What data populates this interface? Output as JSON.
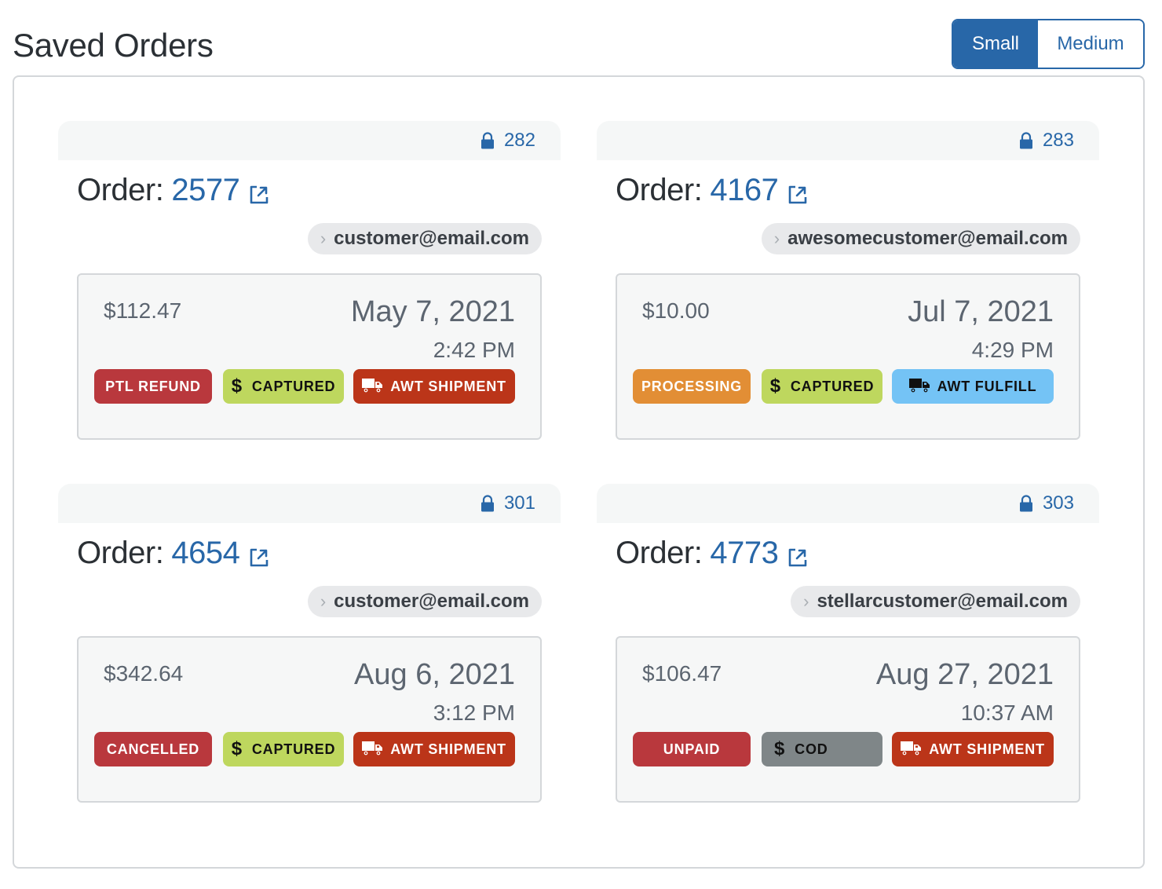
{
  "page_title": "Saved Orders",
  "size_toggle": {
    "options": [
      {
        "label": "Small",
        "selected": true
      },
      {
        "label": "Medium",
        "selected": false
      }
    ]
  },
  "colors": {
    "primary": "#2867a8",
    "danger": "#b9383d",
    "captured": "#bed75e",
    "processing": "#e28e35",
    "shipment": "#bb3519",
    "fulfill": "#74c3f5",
    "cod": "#7f8688"
  },
  "order_label": "Order:",
  "orders": [
    {
      "lock_id": "282",
      "order_number": "2577",
      "email": "customer@email.com",
      "amount": "$112.47",
      "date": "May 7, 2021",
      "time": "2:42 PM",
      "badges": [
        {
          "label": "PTL REFUND",
          "icon": "",
          "bg": "#b9383d",
          "fg": "#ffffff"
        },
        {
          "label": "CAPTURED",
          "icon": "dollar-icon",
          "bg": "#bed75e",
          "fg": "#111111"
        },
        {
          "label": "AWT SHIPMENT",
          "icon": "truck-icon",
          "bg": "#bb3519",
          "fg": "#ffffff"
        }
      ]
    },
    {
      "lock_id": "283",
      "order_number": "4167",
      "email": "awesomecustomer@email.com",
      "amount": "$10.00",
      "date": "Jul 7, 2021",
      "time": "4:29 PM",
      "badges": [
        {
          "label": "PROCESSING",
          "icon": "",
          "bg": "#e28e35",
          "fg": "#ffffff"
        },
        {
          "label": "CAPTURED",
          "icon": "dollar-icon",
          "bg": "#bed75e",
          "fg": "#111111"
        },
        {
          "label": "AWT FULFILL",
          "icon": "truck-icon",
          "bg": "#74c3f5",
          "fg": "#111111"
        }
      ]
    },
    {
      "lock_id": "301",
      "order_number": "4654",
      "email": "customer@email.com",
      "amount": "$342.64",
      "date": "Aug 6, 2021",
      "time": "3:12 PM",
      "badges": [
        {
          "label": "CANCELLED",
          "icon": "",
          "bg": "#b9383d",
          "fg": "#ffffff"
        },
        {
          "label": "CAPTURED",
          "icon": "dollar-icon",
          "bg": "#bed75e",
          "fg": "#111111"
        },
        {
          "label": "AWT SHIPMENT",
          "icon": "truck-icon",
          "bg": "#bb3519",
          "fg": "#ffffff"
        }
      ]
    },
    {
      "lock_id": "303",
      "order_number": "4773",
      "email": "stellarcustomer@email.com",
      "amount": "$106.47",
      "date": "Aug 27, 2021",
      "time": "10:37 AM",
      "badges": [
        {
          "label": "UNPAID",
          "icon": "",
          "bg": "#b9383d",
          "fg": "#ffffff"
        },
        {
          "label": "COD",
          "icon": "dollar-icon",
          "bg": "#7f8688",
          "fg": "#111111"
        },
        {
          "label": "AWT SHIPMENT",
          "icon": "truck-icon",
          "bg": "#bb3519",
          "fg": "#ffffff"
        }
      ]
    }
  ]
}
